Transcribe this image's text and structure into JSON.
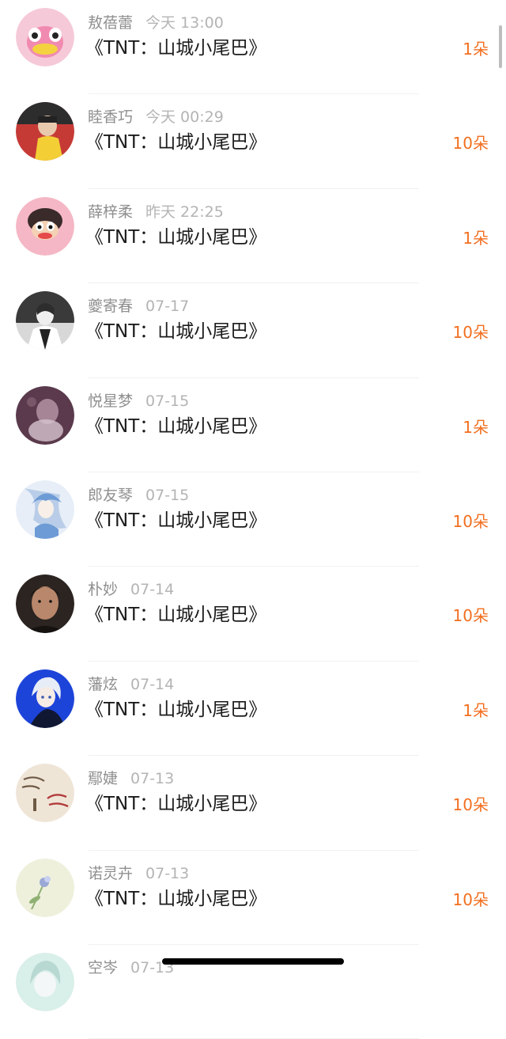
{
  "gifts": [
    {
      "name": "敖蓓蕾",
      "time": "今天 13:00",
      "title": "《TNT：山城小尾巴》",
      "count": "1朵",
      "avatar": {
        "bg": "#f6c9d8",
        "fg": "#f18ab0",
        "accent": "#f4d23f",
        "icon": "pink-duck-avatar-icon"
      }
    },
    {
      "name": "睦香巧",
      "time": "今天 00:29",
      "title": "《TNT：山城小尾巴》",
      "count": "10朵",
      "avatar": {
        "bg": "#c63a36",
        "fg": "#f3cf35",
        "accent": "#222222",
        "icon": "yellow-shirt-avatar-icon"
      }
    },
    {
      "name": "薛梓柔",
      "time": "昨天 22:25",
      "title": "《TNT：山城小尾巴》",
      "count": "1朵",
      "avatar": {
        "bg": "#f5b7c5",
        "fg": "#3a2a2a",
        "accent": "#e5494a",
        "icon": "monkey-avatar-icon"
      }
    },
    {
      "name": "夔寄春",
      "time": "07-17",
      "title": "《TNT：山城小尾巴》",
      "count": "10朵",
      "avatar": {
        "bg": "#d8d8d8",
        "fg": "#2d2d2d",
        "accent": "#ffffff",
        "icon": "portrait-bw-avatar-icon"
      }
    },
    {
      "name": "悦星梦",
      "time": "07-15",
      "title": "《TNT：山城小尾巴》",
      "count": "1朵",
      "avatar": {
        "bg": "#5a3a4c",
        "fg": "#a68597",
        "accent": "#d7c4cf",
        "icon": "dark-figure-avatar-icon"
      }
    },
    {
      "name": "郎友琴",
      "time": "07-15",
      "title": "《TNT：山城小尾巴》",
      "count": "10朵",
      "avatar": {
        "bg": "#e7eef7",
        "fg": "#6d9bd5",
        "accent": "#b9cde8",
        "icon": "anime-blue-avatar-icon"
      }
    },
    {
      "name": "朴妙",
      "time": "07-14",
      "title": "《TNT：山城小尾巴》",
      "count": "10朵",
      "avatar": {
        "bg": "#2b2421",
        "fg": "#b9876b",
        "accent": "#151210",
        "icon": "man-portrait-avatar-icon"
      }
    },
    {
      "name": "藩炫",
      "time": "07-14",
      "title": "《TNT：山城小尾巴》",
      "count": "1朵",
      "avatar": {
        "bg": "#1d44d9",
        "fg": "#e7edf7",
        "accent": "#101733",
        "icon": "anime-white-hair-avatar-icon"
      }
    },
    {
      "name": "鄢婕",
      "time": "07-13",
      "title": "《TNT：山城小尾巴》",
      "count": "10朵",
      "avatar": {
        "bg": "#efe5d7",
        "fg": "#b23b3b",
        "accent": "#6e5a45",
        "icon": "calligraphy-avatar-icon"
      }
    },
    {
      "name": "诺灵卉",
      "time": "07-13",
      "title": "《TNT：山城小尾巴》",
      "count": "10朵",
      "avatar": {
        "bg": "#eef0dc",
        "fg": "#8fb072",
        "accent": "#9aa8d6",
        "icon": "flower-avatar-icon"
      }
    },
    {
      "name": "空岑",
      "time": "07-13",
      "title": "",
      "count": "",
      "avatar": {
        "bg": "#d9efe9",
        "fg": "#f4f7f7",
        "accent": "#b8d8d2",
        "icon": "anime-pale-avatar-icon"
      }
    }
  ]
}
